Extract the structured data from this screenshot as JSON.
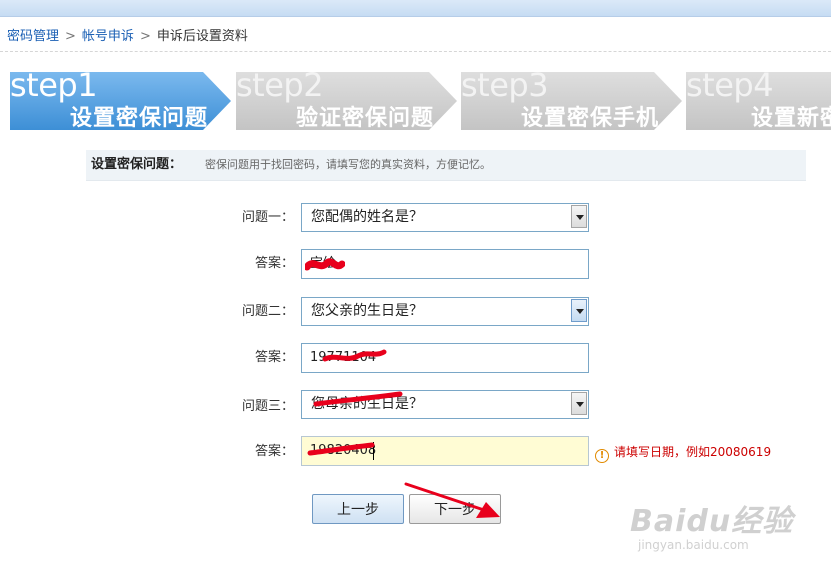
{
  "breadcrumb": {
    "item1": "密码管理",
    "item2": "帐号申诉",
    "current": "申诉后设置资料",
    "separator": ">"
  },
  "steps": [
    {
      "num": "step1",
      "title": "设置密保问题",
      "state": "active"
    },
    {
      "num": "step2",
      "title": "验证密保问题",
      "state": "inactive"
    },
    {
      "num": "step3",
      "title": "设置密保手机",
      "state": "inactive"
    },
    {
      "num": "step4",
      "title": "设置新密",
      "state": "inactive"
    }
  ],
  "info": {
    "label": "设置密保问题：",
    "tip": "密保问题用于找回密码，请填写您的真实资料，方便记忆。"
  },
  "form": {
    "q1_label": "问题一：",
    "q1_value": "您配偶的姓名是？",
    "a1_label": "答案：",
    "a1_value": "宝绘",
    "q2_label": "问题二：",
    "q2_value": "您父亲的生日是？",
    "a2_label": "答案：",
    "a2_value": "19771104",
    "q3_label": "问题三：",
    "q3_value": "您母亲的生日是？",
    "a3_label": "答案：",
    "a3_value": "19820408",
    "error_text": "请填写日期，例如20080619"
  },
  "buttons": {
    "prev": "上一步",
    "next": "下一步"
  },
  "watermark": {
    "brand": "Baidu经验",
    "url": "jingyan.baidu.com"
  },
  "colors": {
    "step_active": "#5aa3e3",
    "step_inactive": "#d2d2d2",
    "error": "#cc0000",
    "scribble": "#e8001c"
  }
}
